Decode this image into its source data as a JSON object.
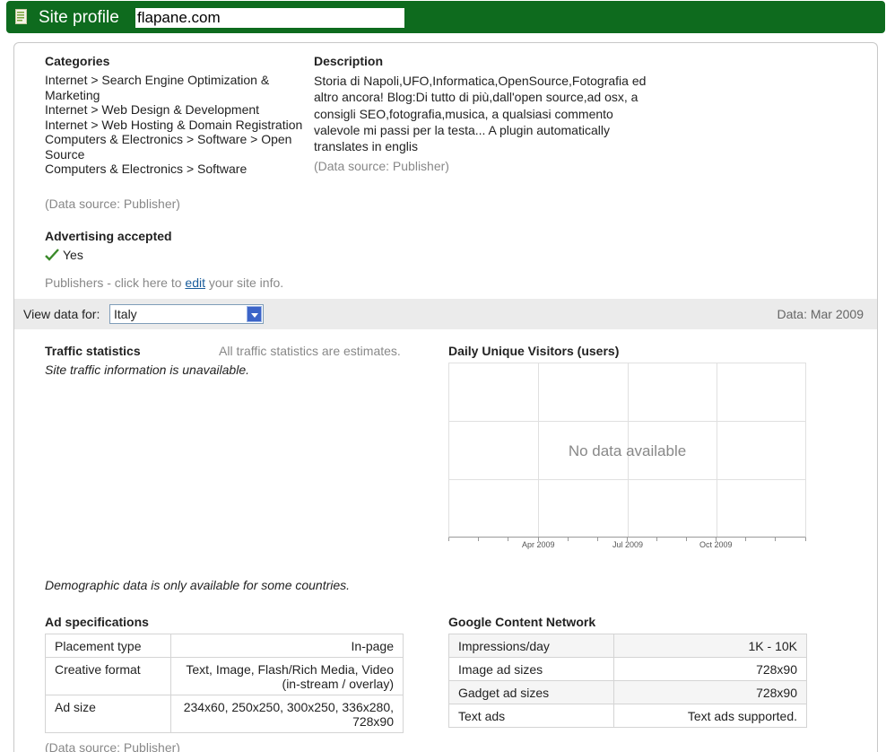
{
  "header": {
    "title": "Site profile",
    "domain": "flapane.com",
    "icon": "document-icon",
    "color": "#0e6b1e"
  },
  "categories": {
    "heading": "Categories",
    "items": [
      "Internet > Search Engine Optimization & Marketing",
      "Internet > Web Design & Development",
      "Internet > Web Hosting & Domain Registration",
      "Computers & Electronics > Software > Open Source",
      "Computers & Electronics > Software"
    ],
    "source": "(Data source: Publisher)"
  },
  "description": {
    "heading": "Description",
    "text": "Storia di Napoli,UFO,Informatica,OpenSource,Fotografia ed altro ancora! Blog:Di tutto di più,dall'open source,ad osx, a consigli SEO,fotografia,musica, a qualsiasi commento valevole mi passi per la testa... A plugin automatically translates in englis",
    "source": "(Data source: Publisher)"
  },
  "advertising": {
    "heading": "Advertising accepted",
    "value": "Yes",
    "icon": "checkmark-icon"
  },
  "publishers": {
    "prefix": "Publishers - click here to ",
    "link": "edit",
    "suffix": " your site info."
  },
  "viewbar": {
    "label": "View data for:",
    "selected": "Italy",
    "date": "Data: Mar 2009"
  },
  "traffic": {
    "heading": "Traffic statistics",
    "note": "All traffic statistics are estimates.",
    "unavailable": "Site traffic information is unavailable."
  },
  "visitors": {
    "heading": "Daily Unique Visitors (users)",
    "nodata": "No data available",
    "x_labels": [
      "Apr 2009",
      "Jul 2009",
      "Oct 2009"
    ]
  },
  "demographic_note": "Demographic data is only available for some countries.",
  "ad_specs": {
    "heading": "Ad specifications",
    "rows": [
      {
        "label": "Placement type",
        "value": "In-page"
      },
      {
        "label": "Creative format",
        "value": "Text, Image, Flash/Rich Media, Video (in-stream / overlay)"
      },
      {
        "label": "Ad size",
        "value": "234x60, 250x250, 300x250, 336x280, 728x90"
      }
    ],
    "source": "(Data source: Publisher)"
  },
  "gcn": {
    "heading": "Google Content Network",
    "rows": [
      {
        "label": "Impressions/day",
        "value": "1K - 10K"
      },
      {
        "label": "Image ad sizes",
        "value": "728x90"
      },
      {
        "label": "Gadget ad sizes",
        "value": "728x90"
      },
      {
        "label": "Text ads",
        "value": "Text ads supported."
      }
    ]
  }
}
